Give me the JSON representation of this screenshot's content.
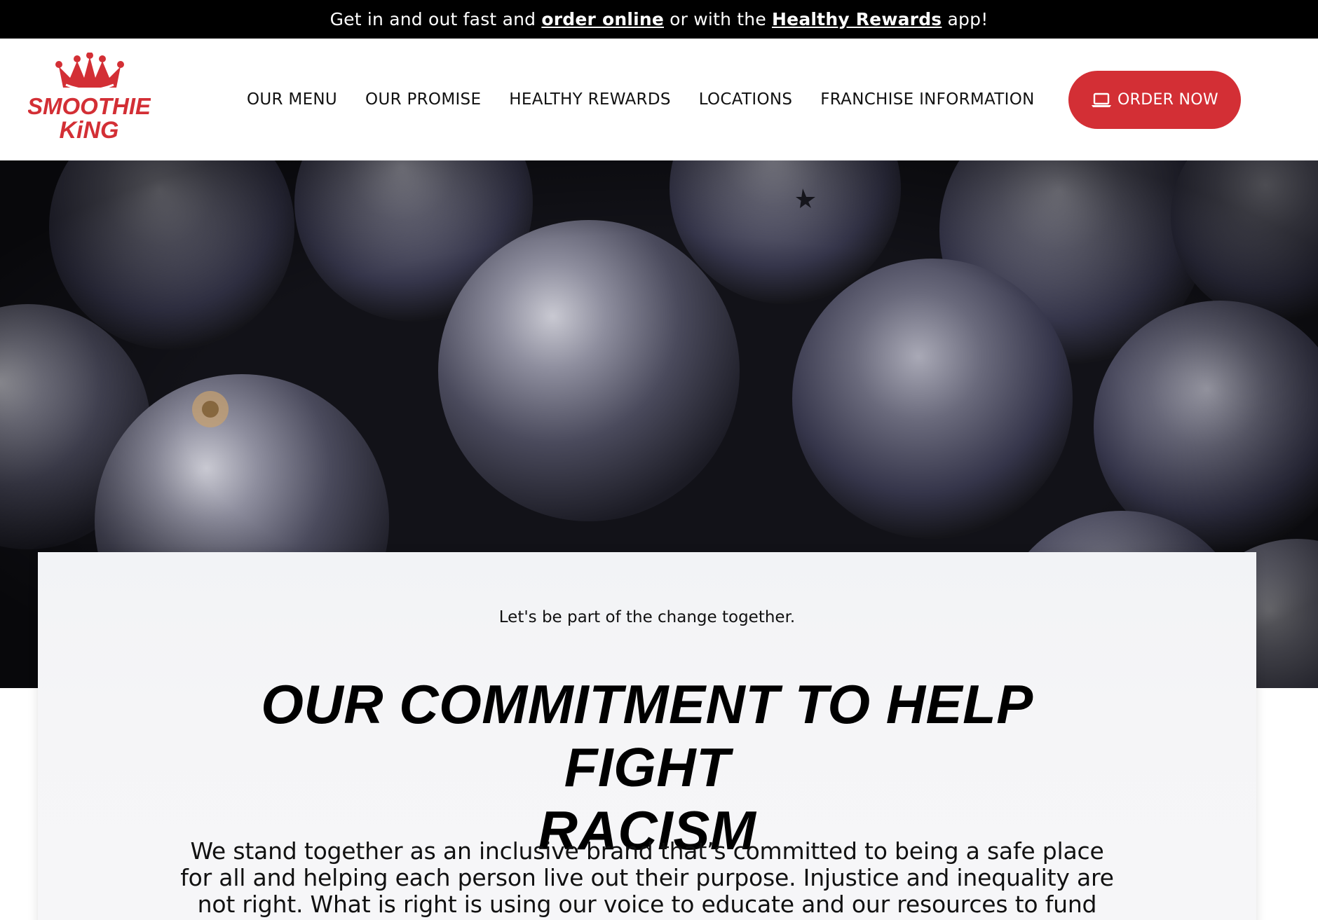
{
  "announcement": {
    "prefix": "Get in and out fast and ",
    "order_link": "order online",
    "middle": " or with the ",
    "rewards_link": "Healthy Rewards",
    "suffix": " app!"
  },
  "brand": {
    "logo_line1": "SMOOTHIE",
    "logo_line2": "KiNG",
    "color": "#d32f35"
  },
  "nav": {
    "items": [
      {
        "label": "OUR MENU"
      },
      {
        "label": "OUR PROMISE"
      },
      {
        "label": "HEALTHY REWARDS"
      },
      {
        "label": "LOCATIONS"
      },
      {
        "label": "FRANCHISE INFORMATION"
      }
    ],
    "order_button": "ORDER NOW",
    "order_icon": "laptop-icon"
  },
  "hero": {
    "image": "blueberries close-up"
  },
  "content": {
    "tagline": "Let's be part of the change together.",
    "headline_line1": "OUR COMMITMENT TO HELP FIGHT",
    "headline_line2": "RACISM",
    "body": "We stand together as an inclusive brand that’s committed to being a safe place for all and helping each person live out their purpose. Injustice and inequality are not right. What is right is using our voice to educate and our resources to fund causes that fight"
  }
}
